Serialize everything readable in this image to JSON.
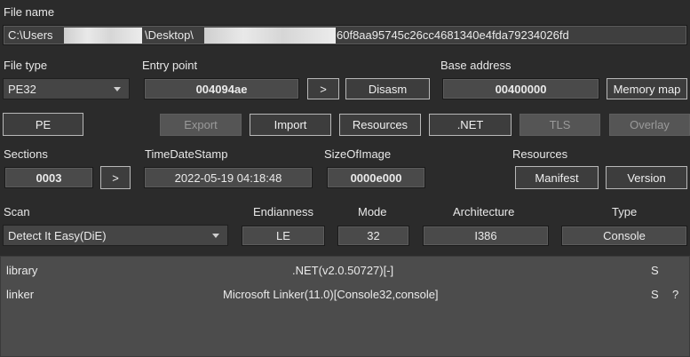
{
  "file": {
    "label": "File name",
    "path_start": "C:\\Users",
    "path_mid": "\\Desktop\\",
    "path_end": "60f8aa95745c26cc4681340e4fda79234026fd"
  },
  "file_type": {
    "label": "File type",
    "value": "PE32"
  },
  "entry_point": {
    "label": "Entry point",
    "value": "004094ae",
    "go_label": ">",
    "disasm_label": "Disasm"
  },
  "base_address": {
    "label": "Base address",
    "value": "00400000",
    "memory_map_label": "Memory map"
  },
  "buttons": {
    "pe": "PE",
    "export": "Export",
    "import": "Import",
    "resources": "Resources",
    "net": ".NET",
    "tls": "TLS",
    "overlay": "Overlay"
  },
  "sections": {
    "label": "Sections",
    "value": "0003",
    "go_label": ">"
  },
  "timedatestamp": {
    "label": "TimeDateStamp",
    "value": "2022-05-19 04:18:48"
  },
  "sizeofimage": {
    "label": "SizeOfImage",
    "value": "0000e000"
  },
  "resources_group": {
    "label": "Resources",
    "manifest": "Manifest",
    "version": "Version"
  },
  "scan": {
    "label": "Scan",
    "value": "Detect It Easy(DiE)"
  },
  "info": {
    "endianness_label": "Endianness",
    "endianness": "LE",
    "mode_label": "Mode",
    "mode": "32",
    "architecture_label": "Architecture",
    "architecture": "I386",
    "type_label": "Type",
    "type": "Console"
  },
  "results": [
    {
      "type": "library",
      "name": ".NET(v2.0.50727)[-]",
      "flag": "S",
      "extra": ""
    },
    {
      "type": "linker",
      "name": "Microsoft Linker(11.0)[Console32,console]",
      "flag": "S",
      "extra": "?"
    }
  ],
  "colors": {
    "background": "#2b2b2b",
    "field": "#4a4a4a",
    "results_bg": "#4c4c4c"
  }
}
